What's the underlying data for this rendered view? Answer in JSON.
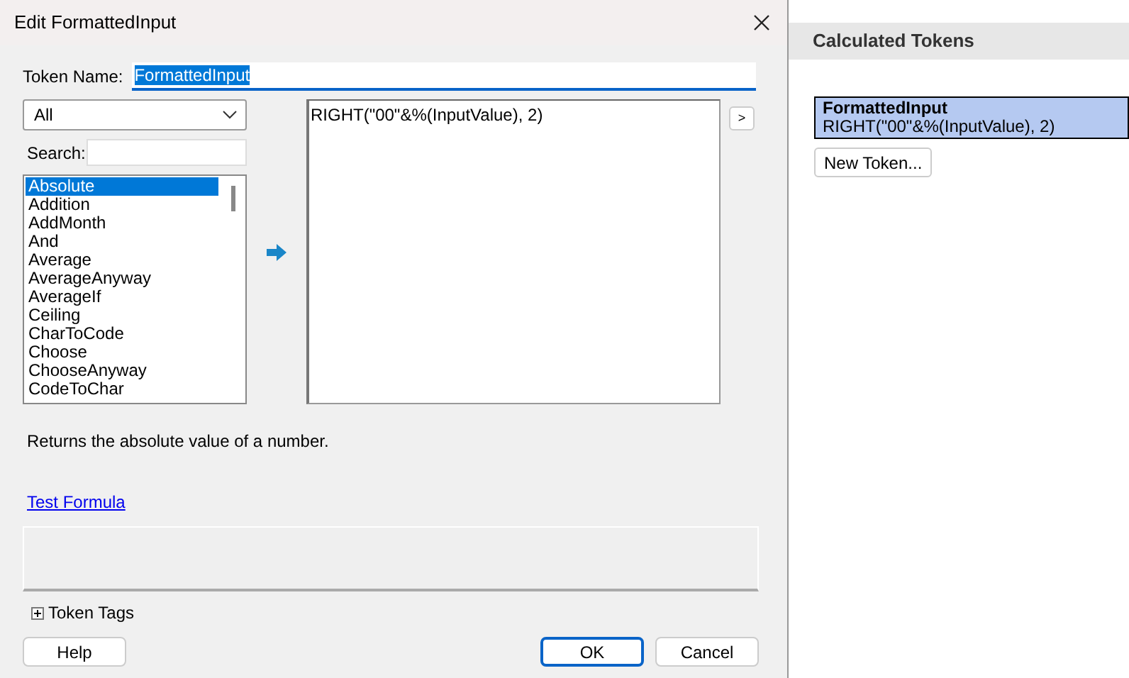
{
  "dialog": {
    "title": "Edit FormattedInput",
    "token_name_label": "Token Name:",
    "token_name": "FormattedInput",
    "token_name_selected": true,
    "category": "All",
    "search_label": "Search:",
    "functions": [
      {
        "label": "Absolute",
        "selected": true
      },
      {
        "label": "Addition",
        "selected": false
      },
      {
        "label": "AddMonth",
        "selected": false
      },
      {
        "label": "And",
        "selected": false
      },
      {
        "label": "Average",
        "selected": false
      },
      {
        "label": "AverageAnyway",
        "selected": false
      },
      {
        "label": "AverageIf",
        "selected": false
      },
      {
        "label": "Ceiling",
        "selected": false
      },
      {
        "label": "CharToCode",
        "selected": false
      },
      {
        "label": "Choose",
        "selected": false
      },
      {
        "label": "ChooseAnyway",
        "selected": false
      },
      {
        "label": "CodeToChar",
        "selected": false
      }
    ],
    "formula": "RIGHT(\"00\"&%(InputValue), 2)",
    "expand_button": ">",
    "description": "Returns the absolute value of a number.",
    "test_link": "Test Formula",
    "token_tags": {
      "label": "Token Tags",
      "expanded": false
    },
    "buttons": [
      {
        "label": "Help",
        "default": false
      },
      {
        "label": "OK",
        "default": true
      },
      {
        "label": "Cancel",
        "default": false
      }
    ]
  },
  "panel": {
    "title": "Calculated Tokens",
    "tokens": [
      {
        "name": "FormattedInput",
        "formula": "RIGHT(\"00\"&%(InputValue), 2)",
        "selected": true
      }
    ],
    "new_button": "New Token..."
  }
}
